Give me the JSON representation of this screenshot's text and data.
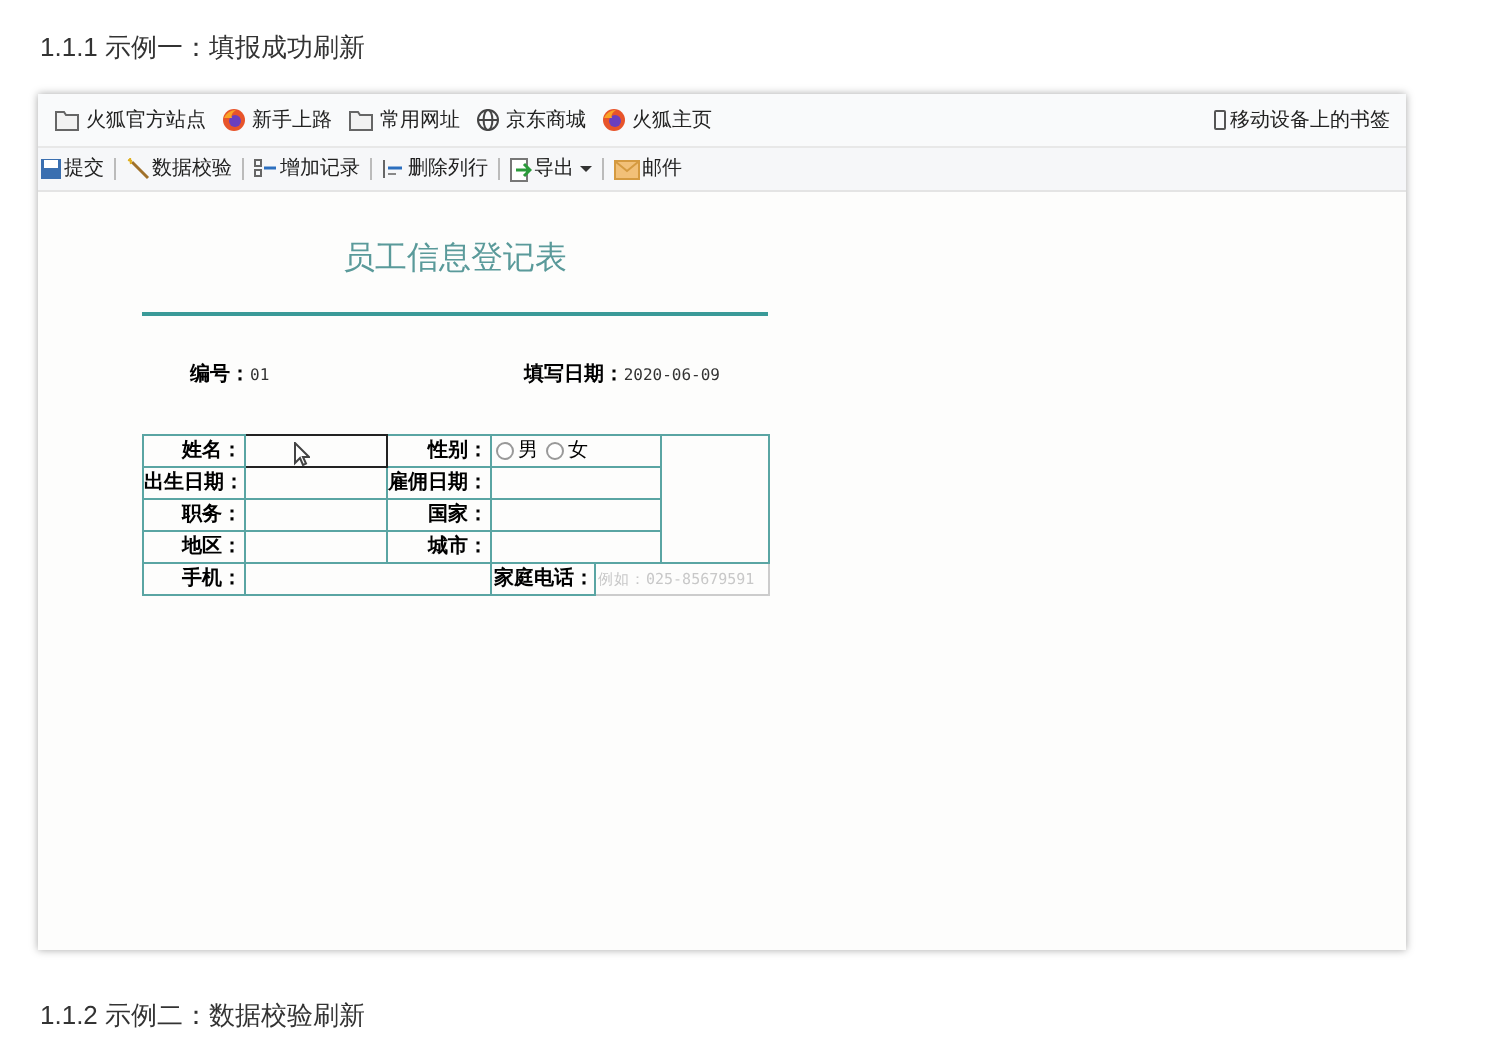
{
  "headings": [
    {
      "text": "1.1.1 示例一：填报成功刷新"
    },
    {
      "text": "1.1.2 示例二：数据校验刷新"
    }
  ],
  "bookmarks": [
    {
      "label": "火狐官方站点",
      "kind": "folder"
    },
    {
      "label": "新手上路",
      "kind": "firefox"
    },
    {
      "label": "常用网址",
      "kind": "folder"
    },
    {
      "label": "京东商城",
      "kind": "globe"
    },
    {
      "label": "火狐主页",
      "kind": "firefox"
    }
  ],
  "mobile_bookmarks": "移动设备上的书签",
  "toolbar": [
    {
      "label": "提交",
      "kind": "save",
      "dropdown": false
    },
    {
      "label": "数据校验",
      "kind": "wand",
      "dropdown": false
    },
    {
      "label": "增加记录",
      "kind": "addrow",
      "dropdown": false
    },
    {
      "label": "删除列行",
      "kind": "delrow",
      "dropdown": false
    },
    {
      "label": "导出",
      "kind": "export",
      "dropdown": true
    },
    {
      "label": "邮件",
      "kind": "mail",
      "dropdown": false
    }
  ],
  "form": {
    "title": "员工信息登记表",
    "number_label": "编号：",
    "number_value": "01",
    "date_label": "填写日期：",
    "date_value": "2020-06-09",
    "rows": [
      {
        "cells": [
          {
            "kind": "label",
            "text": "姓名："
          },
          {
            "kind": "input",
            "focused": true
          },
          {
            "kind": "label",
            "text": "性别："
          },
          {
            "kind": "radio",
            "colspan": 2,
            "options": [
              {
                "label": "男",
                "selected": false
              },
              {
                "label": "女",
                "selected": false
              }
            ]
          },
          {
            "kind": "photo"
          }
        ]
      },
      {
        "cells": [
          {
            "kind": "label",
            "text": "出生日期："
          },
          {
            "kind": "input",
            "focused": false
          },
          {
            "kind": "label",
            "text": "雇佣日期："
          },
          {
            "kind": "input",
            "colspan": 2,
            "focused": false
          }
        ]
      },
      {
        "cells": [
          {
            "kind": "label",
            "text": "职务："
          },
          {
            "kind": "input",
            "focused": false
          },
          {
            "kind": "label",
            "text": "国家："
          },
          {
            "kind": "input",
            "colspan": 2,
            "focused": false
          }
        ]
      },
      {
        "cells": [
          {
            "kind": "label",
            "text": "地区："
          },
          {
            "kind": "input",
            "focused": false
          },
          {
            "kind": "label",
            "text": "城市："
          },
          {
            "kind": "input",
            "colspan": 2,
            "focused": false
          }
        ]
      },
      {
        "cells": [
          {
            "kind": "label",
            "text": "手机："
          },
          {
            "kind": "input",
            "colspan": 2,
            "focused": false
          },
          {
            "kind": "label",
            "text": "家庭电话："
          },
          {
            "kind": "input",
            "colspan": 2,
            "focused": false,
            "placeholder": "例如：025-85679591"
          }
        ]
      }
    ]
  }
}
